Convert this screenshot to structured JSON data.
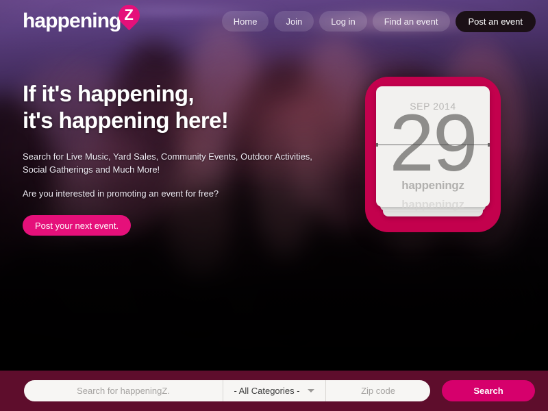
{
  "brand": {
    "logo_word": "happening",
    "logo_pin_letter": "Z",
    "accent_pink": "#e5107a",
    "accent_crimson": "#c3014d",
    "bar_maroon": "#5e0d2c",
    "search_button_pink": "#d6006c"
  },
  "nav": {
    "items": [
      {
        "label": "Home"
      },
      {
        "label": "Join"
      },
      {
        "label": "Log in"
      },
      {
        "label": "Find an event"
      },
      {
        "label": "Post an event"
      }
    ]
  },
  "hero": {
    "headline_line1": "If it's happening,",
    "headline_line2": "it's happening here!",
    "subcopy_1": "Search for Live Music, Yard Sales, Community Events, Outdoor Activities, Social Gatherings and Much More!",
    "subcopy_2": "Are you interested in promoting an event for free?",
    "cta_label": "Post your next event."
  },
  "calendar": {
    "month": "SEP 2014",
    "day": "29",
    "brand": "happeningz",
    "brand_ghost": "happeningz"
  },
  "search": {
    "query_value": "",
    "query_placeholder": "Search for happeningZ.",
    "category_selected": "- All Categories -",
    "zip_value": "",
    "zip_placeholder": "Zip code",
    "button_label": "Search"
  }
}
